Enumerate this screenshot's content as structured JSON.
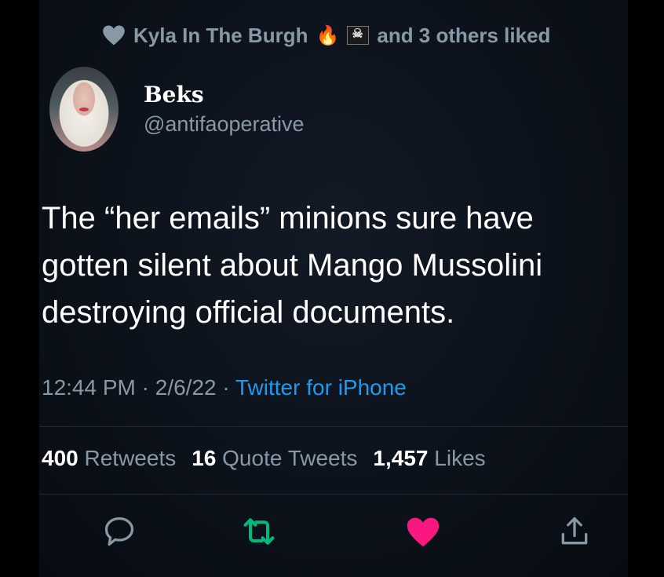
{
  "social_context": {
    "liked_by": "Kyla In The Burgh",
    "fire_emoji": "🔥",
    "suffix": "and 3 others liked"
  },
  "author": {
    "name": "Beks",
    "handle": "@antifaoperative"
  },
  "tweet": {
    "lines": [
      "The “her emails” minions sure have",
      "gotten silent about Mango Mussolini",
      "destroying official documents."
    ]
  },
  "meta": {
    "time": "12:44 PM",
    "sep1": "·",
    "date": "2/6/22",
    "sep2": "·",
    "source": "Twitter for iPhone"
  },
  "stats": {
    "retweets_count": "400",
    "retweets_label": "Retweets",
    "quotes_count": "16",
    "quotes_label": "Quote Tweets",
    "likes_count": "1,457",
    "likes_label": "Likes"
  },
  "colors": {
    "background": "#000000",
    "card": "#0c121b",
    "secondary_text": "#8899a6",
    "link": "#1d9bf0",
    "retweet_green": "#00ba7c",
    "like_pink": "#f91880"
  },
  "icons": {
    "social_heart": "heart-icon",
    "flag": "pirate-flag-icon",
    "reply": "reply-icon",
    "retweet": "retweet-icon",
    "like": "like-heart-icon",
    "share": "share-icon"
  }
}
